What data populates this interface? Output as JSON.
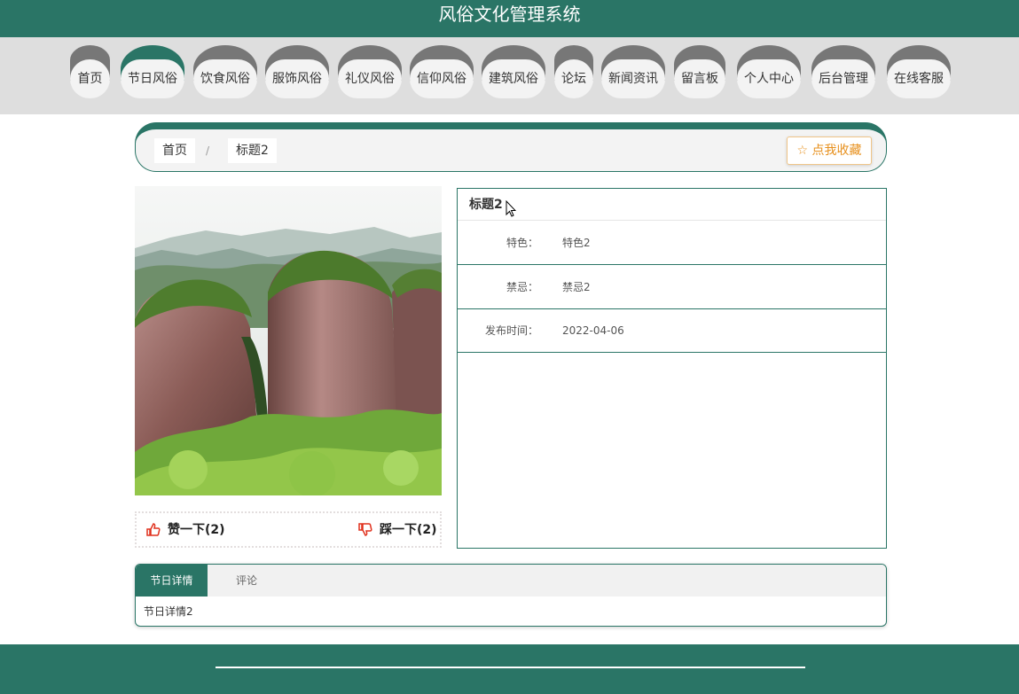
{
  "header": {
    "title": "风俗文化管理系统"
  },
  "nav": {
    "active_index": 1,
    "items": [
      {
        "label": "首页"
      },
      {
        "label": "节日风俗"
      },
      {
        "label": "饮食风俗"
      },
      {
        "label": "服饰风俗"
      },
      {
        "label": "礼仪风俗"
      },
      {
        "label": "信仰风俗"
      },
      {
        "label": "建筑风俗"
      },
      {
        "label": "论坛"
      },
      {
        "label": "新闻资讯"
      },
      {
        "label": "留言板"
      },
      {
        "label": "个人中心"
      },
      {
        "label": "后台管理"
      },
      {
        "label": "在线客服"
      }
    ]
  },
  "breadcrumb": {
    "home": "首页",
    "separator": "/",
    "current": "标题2"
  },
  "favorite": {
    "icon": "star-outline-icon",
    "label": "☆ 点我收藏"
  },
  "detail": {
    "title": "标题2",
    "fields": [
      {
        "label": "特色：",
        "value": "特色2"
      },
      {
        "label": "禁忌：",
        "value": "禁忌2"
      },
      {
        "label": "发布时间：",
        "value": "2022-04-06"
      }
    ]
  },
  "votes": {
    "like": {
      "icon": "thumbs-up-icon",
      "label": "赞一下(2)"
    },
    "dislike": {
      "icon": "thumbs-down-icon",
      "label": "踩一下(2)"
    }
  },
  "tabs": {
    "items": [
      {
        "label": "节日详情"
      },
      {
        "label": "评论"
      }
    ],
    "content": "节日详情2"
  },
  "colors": {
    "primary": "#2a7566",
    "nav_cap": "#777777",
    "accent": "#e7901d",
    "vote_icon": "#e0321e"
  }
}
